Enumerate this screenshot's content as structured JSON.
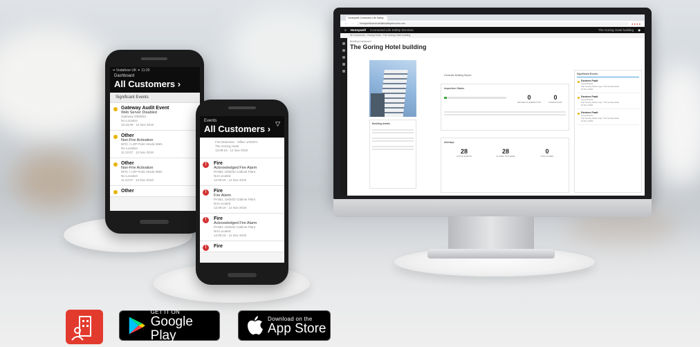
{
  "phone_back": {
    "status": "•• Vodafone UK  ✦        11:20",
    "sub": "Dashboard",
    "title": "All Customers ›",
    "section": "Significant Events",
    "events": [
      {
        "title": "Gateway Audit Event",
        "sub": "Web Server Disabled",
        "meta": "Gateway 0000001\nNo Location\n10:43:09 · 12 Nov 2019",
        "color": "#e8b400"
      },
      {
        "title": "Other",
        "sub": "Non-Fire Activation",
        "meta": "NFIC / LOP Point        Vesda NNN\nNo Location\n11:13:07 · 12 Nov 2019",
        "color": "#e8b400"
      },
      {
        "title": "Other",
        "sub": "Non-Fire Activation",
        "meta": "NFIC / LOP Point        Vesda NNN\nNo Location\n11:13:07 · 12 Nov 2019",
        "color": "#e8b400"
      },
      {
        "title": "Other",
        "sub": "",
        "meta": "",
        "color": "#e8b400"
      }
    ]
  },
  "phone_front": {
    "sub": "Events",
    "title": "All Customers ›",
    "events": [
      {
        "title": "Fire",
        "sub": "Acknowledged Fire Alarm",
        "meta": "PANEL 1/M3/32      Cabinet Plant\nNot Located\n12:09:19 · 12 Nov 2019"
      },
      {
        "title": "Fire",
        "sub": "Fire Alarm",
        "meta": "PANEL 1/M3/32      Cabinet Plant\nNot Located\n12:09:19 · 12 Nov 2019"
      },
      {
        "title": "Fire",
        "sub": "Acknowledged Fire Alarm",
        "meta": "PANEL 1/M3/32      Cabinet Plant\nNot Located\n12:09:19 · 12 Nov 2019"
      },
      {
        "title": "Fire",
        "sub": "",
        "meta": ""
      }
    ]
  },
  "desktop": {
    "tab": "Honeywell Connected Life Safety",
    "url": "honeywellconnectedlifesafetyservices.com",
    "brand": "Honeywell",
    "app_name": "Connected Life Safety Services",
    "building_selector": "The Goring Hotel building",
    "crumb": "All Customers › Goring Hotel › The Goring Hotel building",
    "title_small": "Building Dashboard",
    "title": "The Goring Hotel building",
    "report": "Generate Building Report",
    "inspection": "Inspection Status",
    "kpi1": "0",
    "kpi1_label": "DEVICES IN INSPECTION",
    "kpi2": "0",
    "kpi2_label": "INSPECTIONS",
    "building_details": "Building details",
    "kpi3": "28",
    "kpi3_label": "ACTIVE EVENTS",
    "kpi4": "28",
    "kpi4_label": "CLOSED THIS WEEK",
    "kpi5": "0",
    "kpi5_label": "NON-CLOSED",
    "interlaps": "Interlaps",
    "events_title": "Significant Events",
    "right_events": [
      {
        "title": "Devices Fault",
        "lines": "Loop Monitor\nThe Goring Hotel Loop, The Goring Hotel\n16 Nov 2019"
      },
      {
        "title": "Devices Fault",
        "lines": "Loop Monitor\nThe Goring Hotel Loop, The Goring Hotel\n16 Nov 2019"
      },
      {
        "title": "Devices Fault",
        "lines": "Loop Monitor\nThe Goring Hotel Loop, The Goring Hotel\n16 Nov 2019"
      }
    ]
  },
  "badges": {
    "google_small": "GET IT ON",
    "google_big": "Google Play",
    "apple_small": "Download on the",
    "apple_big": "App Store"
  },
  "colors": {
    "fire": "#d33333",
    "warning": "#e8b400",
    "brand_red": "#e23b2e"
  }
}
